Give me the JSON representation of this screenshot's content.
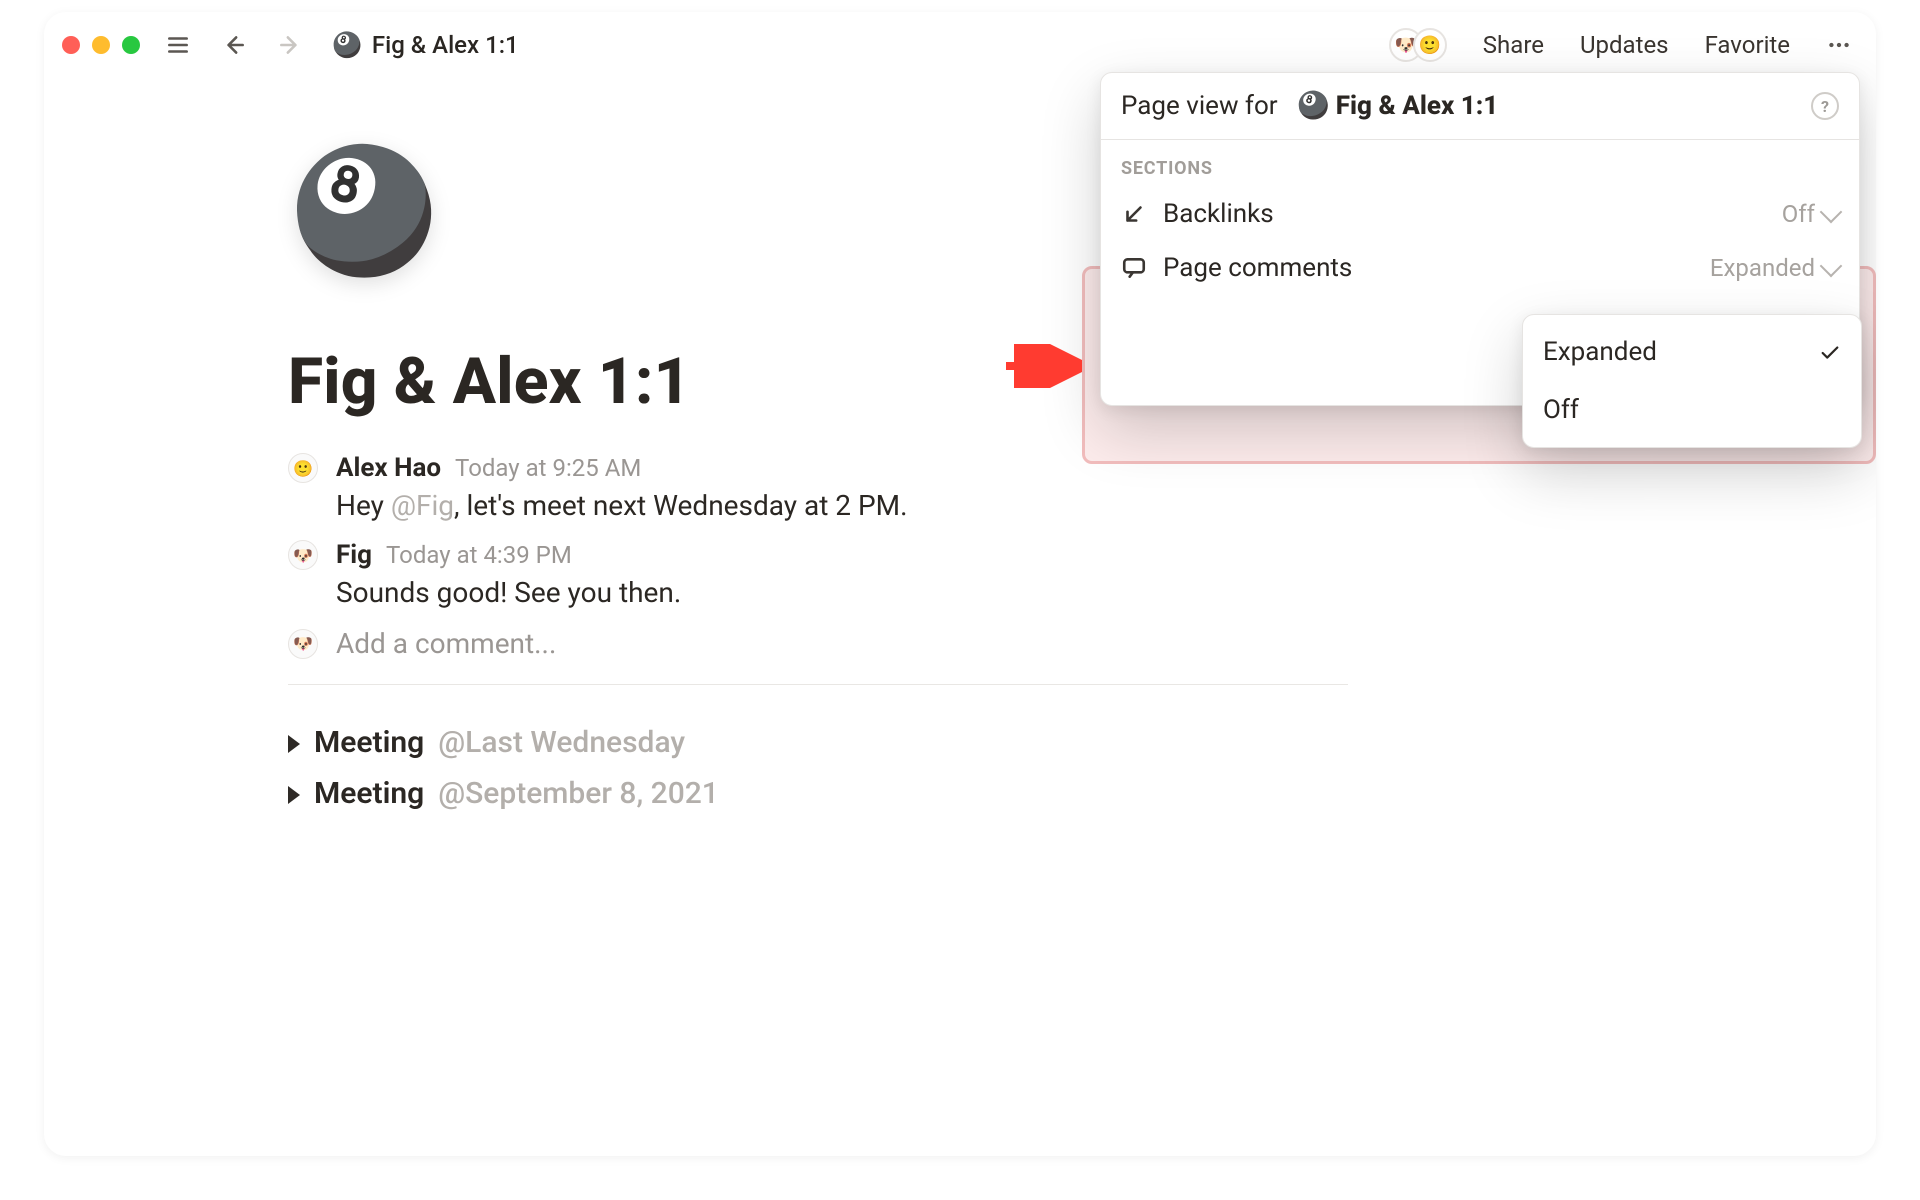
{
  "window": {
    "breadcrumb_icon": "🎱",
    "breadcrumb_title": "Fig & Alex 1:1"
  },
  "topbar": {
    "share": "Share",
    "updates": "Updates",
    "favorite": "Favorite"
  },
  "page": {
    "icon": "🎱",
    "title": "Fig & Alex 1:1",
    "add_comment_placeholder": "Add a comment..."
  },
  "comments": [
    {
      "avatar": "🙂",
      "author": "Alex Hao",
      "time": "Today at 9:25 AM",
      "text_before": "Hey ",
      "mention": "@Fig",
      "text_after": ", let's meet next Wednesday at 2 PM."
    },
    {
      "avatar": "🐶",
      "author": "Fig",
      "time": "Today at 4:39 PM",
      "text_before": "Sounds good! See you then.",
      "mention": "",
      "text_after": ""
    }
  ],
  "toggles": [
    {
      "label": "Meeting",
      "date": "@Last Wednesday"
    },
    {
      "label": "Meeting",
      "date": "@September 8, 2021"
    }
  ],
  "popover": {
    "title_prefix": "Page view for",
    "title_icon": "🎱",
    "title_page": "Fig & Alex 1:1",
    "sections_label": "SECTIONS",
    "rows": {
      "backlinks": {
        "label": "Backlinks",
        "value": "Off"
      },
      "page_comments": {
        "label": "Page comments",
        "value": "Expanded"
      }
    }
  },
  "submenu": {
    "options": [
      {
        "label": "Expanded",
        "selected": true
      },
      {
        "label": "Off",
        "selected": false
      }
    ]
  },
  "presence": {
    "avatars": [
      "🐶",
      "🙂"
    ]
  }
}
